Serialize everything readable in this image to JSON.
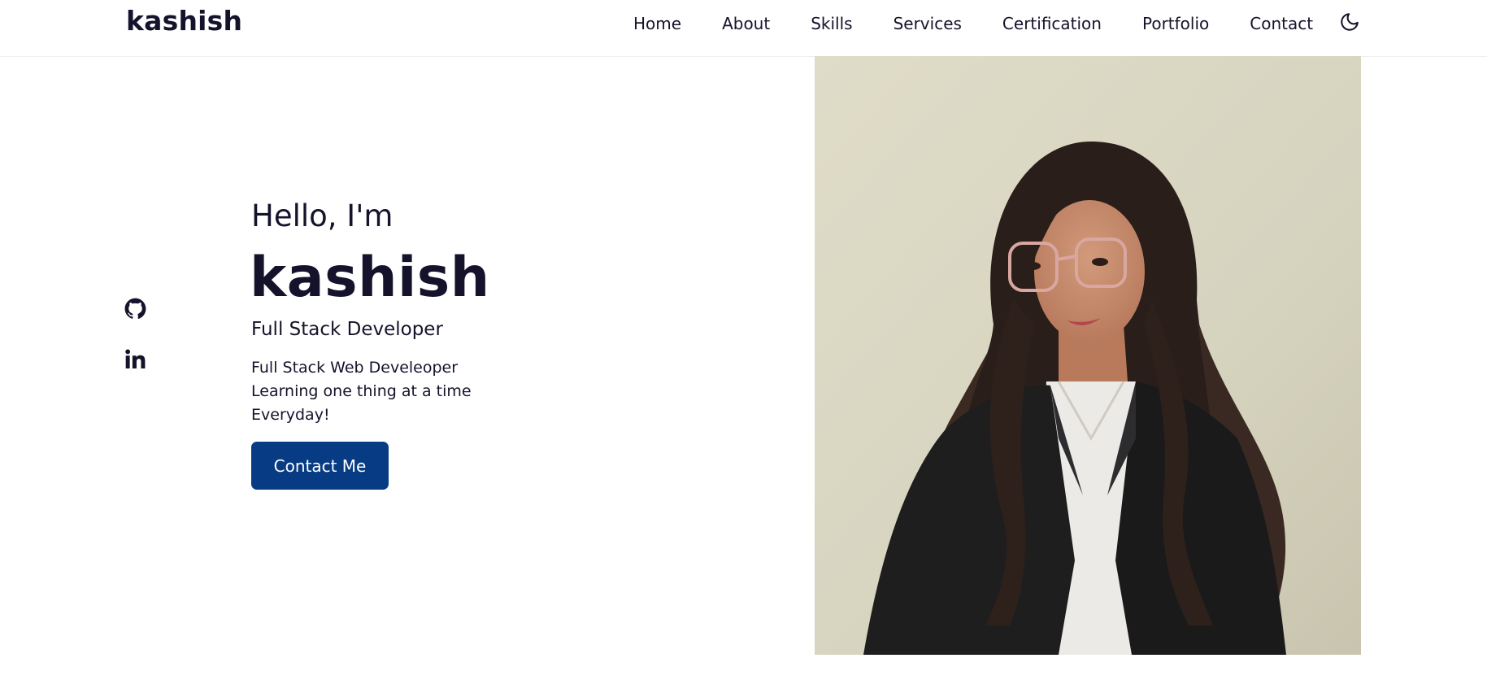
{
  "header": {
    "logo": "kashish",
    "nav": [
      "Home",
      "About",
      "Skills",
      "Services",
      "Certification",
      "Portfolio",
      "Contact"
    ],
    "theme_icon": "moon-icon"
  },
  "social": [
    {
      "icon": "github-icon"
    },
    {
      "icon": "linkedin-icon"
    }
  ],
  "hero": {
    "greeting": "Hello, I'm",
    "name": "kashish",
    "role": "Full Stack Developer",
    "description_lines": [
      "Full Stack Web Develeoper",
      "Learning one thing at a time",
      "Everyday!"
    ],
    "cta_label": "Contact Me"
  },
  "colors": {
    "text": "#14132b",
    "accent": "#073b84",
    "photo_bg": "#dcdac4"
  }
}
